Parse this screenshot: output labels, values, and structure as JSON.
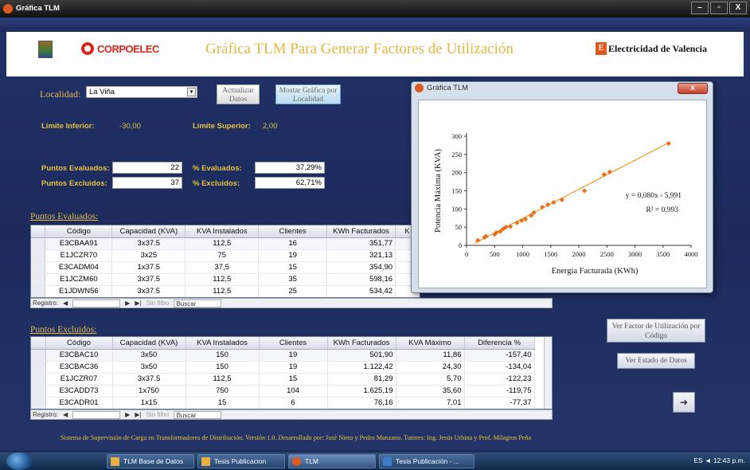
{
  "window": {
    "title": "Gráfica TLM",
    "min": "–",
    "max": "▫",
    "close": "X"
  },
  "banner": {
    "title": "Gráfica TLM Para Generar Factores de Utilización",
    "corpoelec": "CORPOELEC",
    "elec": "Electricidad de Valencia",
    "elec_mark": "E"
  },
  "filters": {
    "localidad_label": "Localidad:",
    "localidad_value": "La Viña",
    "update_button": "Actualizar Datos",
    "show_chart_button": "Mostar Gráfica por Localidad",
    "lim_inf_label": "Límite Inferior:",
    "lim_inf_value": "-30,00",
    "lim_sup_label": "Límite Superior:",
    "lim_sup_value": "2,00",
    "evaluados_label": "Puntos Evaluados:",
    "evaluados_value": "22",
    "excluidos_label": "Puntos Excluidos:",
    "excluidos_value": "37",
    "pct_eval_label": "% Evaluados:",
    "pct_eval_value": "37,29%",
    "pct_excl_label": "% Excluidos:",
    "pct_excl_value": "62,71%"
  },
  "grid1": {
    "label": "Puntos Evaluados:",
    "headers": [
      "Código",
      "Capacidad (KVA)",
      "KVA Instalados",
      "Clientes",
      "KWh Facturados",
      "K"
    ],
    "rows": [
      [
        "E3CBAA91",
        "3x37.5",
        "112,5",
        "16",
        "351,77"
      ],
      [
        "E1JCZR70",
        "3x25",
        "75",
        "19",
        "321,13"
      ],
      [
        "E3CADM04",
        "1x37.5",
        "37,5",
        "15",
        "354,90"
      ],
      [
        "E1JCZM60",
        "3x37.5",
        "112,5",
        "35",
        "598,16"
      ],
      [
        "E1JDWN56",
        "3x37.5",
        "112,5",
        "25",
        "534,42"
      ]
    ]
  },
  "grid2": {
    "label": "Puntos Excluidos:",
    "headers": [
      "Código",
      "Capacidad (KVA)",
      "KVA Instalados",
      "Clientes",
      "KWh Facturados",
      "KVA Máximo",
      "Diferencia %"
    ],
    "rows": [
      [
        "E3CBAC10",
        "3x50",
        "150",
        "19",
        "501,90",
        "11,86",
        "-157,40"
      ],
      [
        "E3CBAC36",
        "3x50",
        "150",
        "19",
        "1.122,42",
        "24,30",
        "-134,04"
      ],
      [
        "E1JCZR07",
        "3x37.5",
        "112,5",
        "15",
        "81,29",
        "5,70",
        "-122,23"
      ],
      [
        "E3CADD73",
        "1x750",
        "750",
        "104",
        "1.625,19",
        "35,60",
        "-119,75"
      ],
      [
        "E3CADR01",
        "1x15",
        "15",
        "6",
        "76,16",
        "7,01",
        "-77,37"
      ]
    ]
  },
  "nav": {
    "registro": "Registro:",
    "first": "◀",
    "prev": "◀",
    "next": "▶",
    "last": "▶|",
    "filter": "Sin filtro",
    "search": "Buscar"
  },
  "buttons": {
    "factor": "Ver Factor de Utilización por Código",
    "estado": "Ver Estado de Datos",
    "exit": "➜"
  },
  "status": "Sistema de Supervisión de Carga en Transformadores de Distribución. Versión 1.0.    Desarrollado por: José Nieto y Pedro Manzano.  Tutores: Ing. Jesús Urbina y Prof. Milagros Peña",
  "taskbar": {
    "items": [
      "TLM Base de Datos",
      "Tesis Publicacion",
      "TLM",
      "Tesis Publicación - ..."
    ],
    "tray": "ES  ◄    12:43 p.m."
  },
  "popup": {
    "title": "Gráfica TLM",
    "close": "x"
  },
  "chart_data": {
    "type": "scatter",
    "xlabel": "Energia Facturada (KWh)",
    "ylabel": "Potencia Máxima (KVA)",
    "xlim": [
      0,
      4000
    ],
    "ylim": [
      0,
      300
    ],
    "xticks": [
      "0",
      "500",
      "1000",
      "1500",
      "2000",
      "2500",
      "3000",
      "3500",
      "4000"
    ],
    "yticks": [
      "0",
      "50",
      "100",
      "150",
      "200",
      "250",
      "300"
    ],
    "points": [
      [
        200,
        14
      ],
      [
        320,
        22
      ],
      [
        350,
        25
      ],
      [
        500,
        30
      ],
      [
        530,
        35
      ],
      [
        600,
        38
      ],
      [
        650,
        45
      ],
      [
        700,
        50
      ],
      [
        780,
        52
      ],
      [
        900,
        62
      ],
      [
        980,
        68
      ],
      [
        1050,
        72
      ],
      [
        1150,
        82
      ],
      [
        1200,
        90
      ],
      [
        1350,
        105
      ],
      [
        1450,
        112
      ],
      [
        1550,
        118
      ],
      [
        1700,
        125
      ],
      [
        2100,
        150
      ],
      [
        2450,
        195
      ],
      [
        2550,
        202
      ],
      [
        3600,
        280
      ]
    ],
    "trendline": {
      "slope": 0.08,
      "intercept": -5.991
    },
    "equation": "y = 0,080x - 5,991",
    "r2": "R² = 0,993",
    "colors": {
      "points": "#e8701a",
      "line": "#f0a030"
    }
  }
}
